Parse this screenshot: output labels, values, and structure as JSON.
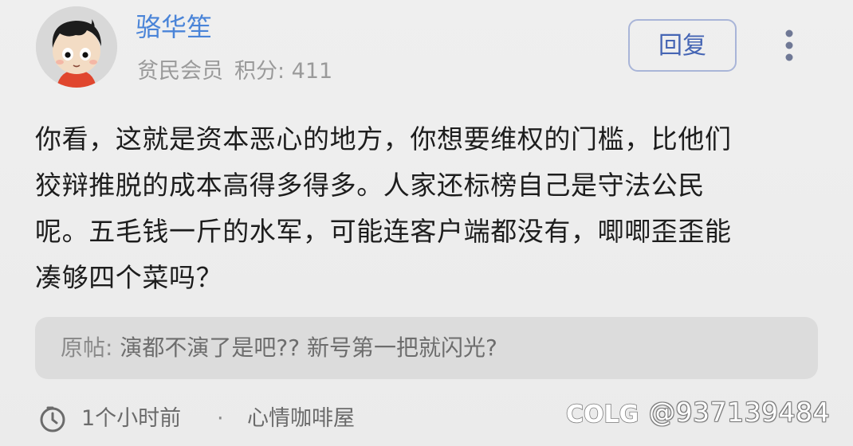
{
  "post": {
    "author": {
      "name": "骆华笙",
      "rank": "贫民会员",
      "points_label": "积分: 411"
    },
    "reply_button_label": "回复",
    "more_icon": "more-vertical-icon",
    "content_lines": [
      "你看，这就是资本恶心的地方，你想要维权的门槛，比他们",
      "狡辩推脱的成本高得多得多。人家还标榜自己是守法公民",
      "呢。五毛钱一斤的水军，可能连客户端都没有，唧唧歪歪能",
      "凑够四个菜吗？"
    ],
    "quote": {
      "label": "原帖: ",
      "text": "演都不演了是吧?? 新号第一把就闪光?"
    },
    "footer": {
      "clock_icon": "clock-icon",
      "time": "1个小时前",
      "separator": "·",
      "forum": "心情咖啡屋"
    }
  },
  "watermark": {
    "logo_text": "COLG",
    "handle": "@937139484"
  },
  "colors": {
    "background": "#ececec",
    "username": "#4a84d8",
    "reply_button_text": "#4565b4",
    "reply_button_border": "#a9b5d8",
    "quote_background": "#dcdcdc"
  }
}
